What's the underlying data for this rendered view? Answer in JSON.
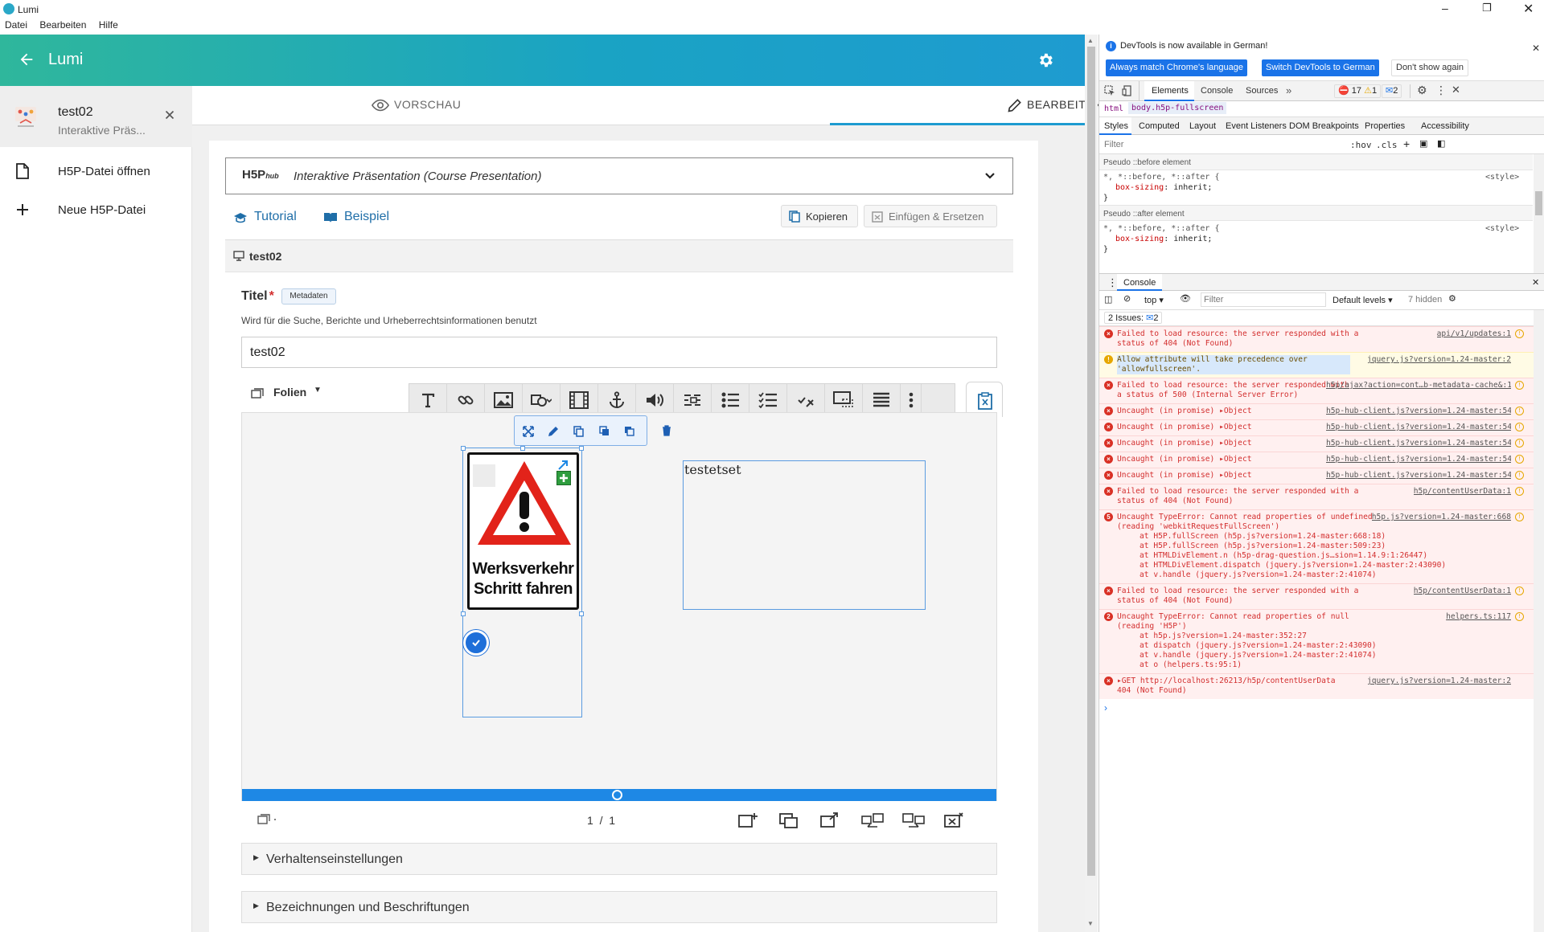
{
  "window": {
    "title": "Lumi",
    "menus": [
      "Datei",
      "Bearbeiten",
      "Hilfe"
    ]
  },
  "header": {
    "title": "Lumi"
  },
  "sidebar": {
    "file": {
      "name": "test02",
      "type": "Interaktive Präs..."
    },
    "items": [
      {
        "label": "H5P-Datei öffnen",
        "icon": "file-icon"
      },
      {
        "label": "Neue H5P-Datei",
        "icon": "plus-icon"
      }
    ]
  },
  "tabs": {
    "preview": "VORSCHAU",
    "edit": "BEARBEITEN"
  },
  "editor": {
    "hub_logo": "H5P",
    "hub_sub": "hub",
    "content_type": "Interaktive Präsentation (Course Presentation)",
    "tutorial": "Tutorial",
    "example": "Beispiel",
    "copy": "Kopieren",
    "paste_replace": "Einfügen & Ersetzen",
    "section_title": "test02",
    "title_label": "Titel",
    "required_mark": "*",
    "metadata_btn": "Metadaten",
    "title_desc": "Wird für die Suche, Berichte und Urheberrechtsinformationen benutzt",
    "title_value": "test02",
    "slides_label": "Folien",
    "text_element": "testetset",
    "sign_line1": "Werksverkehr",
    "sign_line2": "Schritt fahren",
    "pager": "1  /  1",
    "behaviour": "Verhaltenseinstellungen",
    "labels": "Bezeichnungen und Beschriftungen"
  },
  "devtools": {
    "banner": "DevTools is now available in German!",
    "btn_match": "Always match Chrome's language",
    "btn_switch": "Switch DevTools to German",
    "btn_dont": "Don't show again",
    "tabs": [
      "Elements",
      "Console",
      "Sources"
    ],
    "more": "»",
    "err_count": "17",
    "warn_count": "1",
    "msg_count": "2",
    "crumbs": [
      "html",
      "body.h5p-fullscreen"
    ],
    "subtabs": [
      "Styles",
      "Computed",
      "Layout",
      "Event Listeners",
      "DOM Breakpoints",
      "Properties",
      "Accessibility"
    ],
    "filter_placeholder": "Filter",
    "hov": ":hov",
    "cls": ".cls",
    "pseudo_before": "Pseudo ::before element",
    "pseudo_after": "Pseudo ::after element",
    "rule_selector": "*, *::before, *::after {",
    "rule_prop": "box-sizing",
    "rule_val": "inherit;",
    "rule_close": "}",
    "rule_src": "<style>",
    "drawer_tab": "Console",
    "ctx": "top ▾",
    "console_filter": "Filter",
    "levels": "Default levels ▾",
    "hidden": "7 hidden",
    "issues": "2 Issues:",
    "issues_count": "2",
    "prompt": "›",
    "messages": [
      {
        "kind": "err",
        "text": "Failed to load resource: the server responded with a status of 404 (Not Found)",
        "src": "api/v1/updates:1"
      },
      {
        "kind": "warn",
        "text": "Allow attribute will take precedence over 'allowfullscreen'.",
        "src": "jquery.js?version=1.24-master:2"
      },
      {
        "kind": "err",
        "text": "Failed to load resource: the server responded with a status of 500 (Internal Server Error)",
        "src": "h5p/ajax?action=cont…b-metadata-cache&:1"
      },
      {
        "kind": "err",
        "text": "Uncaught (in promise) ▸Object",
        "src": "h5p-hub-client.js?version=1.24-master:54"
      },
      {
        "kind": "err",
        "text": "Uncaught (in promise) ▸Object",
        "src": "h5p-hub-client.js?version=1.24-master:54"
      },
      {
        "kind": "err",
        "text": "Uncaught (in promise) ▸Object",
        "src": "h5p-hub-client.js?version=1.24-master:54"
      },
      {
        "kind": "err",
        "text": "Uncaught (in promise) ▸Object",
        "src": "h5p-hub-client.js?version=1.24-master:54"
      },
      {
        "kind": "err",
        "text": "Uncaught (in promise) ▸Object",
        "src": "h5p-hub-client.js?version=1.24-master:54"
      },
      {
        "kind": "err",
        "text": "Failed to load resource: the server responded with a status of 404 (Not Found)",
        "src": "h5p/contentUserData:1"
      },
      {
        "kind": "err",
        "badge": "5",
        "text": "Uncaught TypeError: Cannot read properties of undefined (reading 'webkitRequestFullScreen')",
        "src": "h5p.js?version=1.24-master:668",
        "stack": [
          "at H5P.fullScreen (h5p.js?version=1.24-master:668:18)",
          "at H5P.fullScreen (h5p.js?version=1.24-master:509:23)",
          "at HTMLDivElement.n (h5p-drag-question.js…sion=1.14.9:1:26447)",
          "at HTMLDivElement.dispatch (jquery.js?version=1.24-master:2:43090)",
          "at v.handle (jquery.js?version=1.24-master:2:41074)"
        ]
      },
      {
        "kind": "err",
        "text": "Failed to load resource: the server responded with a status of 404 (Not Found)",
        "src": "h5p/contentUserData:1"
      },
      {
        "kind": "err",
        "badge": "2",
        "text": "Uncaught TypeError: Cannot read properties of null (reading 'H5P')",
        "src": "helpers.ts:117",
        "stack": [
          "at h5p.js?version=1.24-master:352:27",
          "at dispatch (jquery.js?version=1.24-master:2:43090)",
          "at v.handle (jquery.js?version=1.24-master:2:41074)",
          "at o (helpers.ts:95:1)"
        ]
      },
      {
        "kind": "err",
        "text": "▸GET http://localhost:26213/h5p/contentUserData 404 (Not Found)",
        "src": "jquery.js?version=1.24-master:2"
      }
    ]
  },
  "colors": {
    "accent": "#1e88e5",
    "header_start": "#2fb79c",
    "header_end": "#1e9bd0",
    "error": "#d32f2f"
  }
}
